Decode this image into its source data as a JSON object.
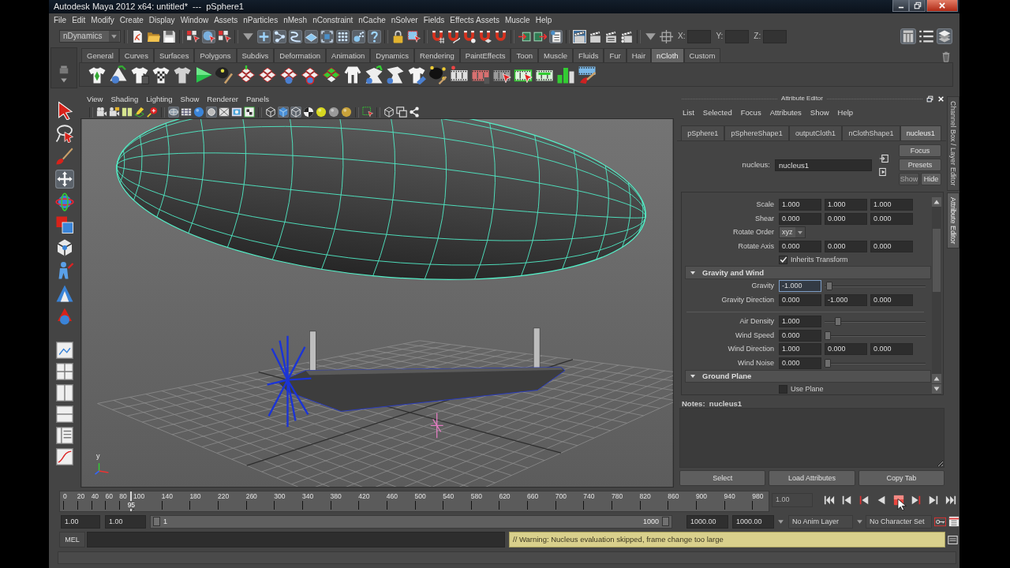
{
  "window": {
    "title": "Autodesk Maya 2012 x64: untitled*  ---  pSphere1"
  },
  "menu_bar": [
    "File",
    "Edit",
    "Modify",
    "Create",
    "Display",
    "Window",
    "Assets",
    "nParticles",
    "nMesh",
    "nConstraint",
    "nCache",
    "nSolver",
    "Fields",
    "Effects Assets",
    "Muscle",
    "Help"
  ],
  "status_line": {
    "menu_set": "nDynamics",
    "coordinate_labels": [
      "X:",
      "Y:",
      "Z:"
    ]
  },
  "shelf": {
    "tabs": [
      {
        "label": "General",
        "selected": false
      },
      {
        "label": "Curves",
        "selected": false
      },
      {
        "label": "Surfaces",
        "selected": false
      },
      {
        "label": "Polygons",
        "selected": false
      },
      {
        "label": "Subdivs",
        "selected": false
      },
      {
        "label": "Deformation",
        "selected": false
      },
      {
        "label": "Animation",
        "selected": false
      },
      {
        "label": "Dynamics",
        "selected": false
      },
      {
        "label": "Rendering",
        "selected": false
      },
      {
        "label": "PaintEffects",
        "selected": false
      },
      {
        "label": "Toon",
        "selected": false
      },
      {
        "label": "Muscle",
        "selected": false
      },
      {
        "label": "Fluids",
        "selected": false
      },
      {
        "label": "Fur",
        "selected": false
      },
      {
        "label": "Hair",
        "selected": false
      },
      {
        "label": "nCloth",
        "selected": true
      },
      {
        "label": "Custom",
        "selected": false
      }
    ]
  },
  "viewport": {
    "menu": [
      "View",
      "Shading",
      "Lighting",
      "Show",
      "Renderer",
      "Panels"
    ],
    "axis_label": "y"
  },
  "attribute_editor": {
    "title": "Attribute Editor",
    "menu": [
      "List",
      "Selected",
      "Focus",
      "Attributes",
      "Show",
      "Help"
    ],
    "tabs": [
      {
        "label": "pSphere1",
        "selected": false
      },
      {
        "label": "pSphereShape1",
        "selected": false
      },
      {
        "label": "outputCloth1",
        "selected": false
      },
      {
        "label": "nClothShape1",
        "selected": false
      },
      {
        "label": "nucleus1",
        "selected": true
      }
    ],
    "node_label": "nucleus:",
    "node_name": "nucleus1",
    "side_buttons": [
      {
        "label": "Focus",
        "disabled": false
      },
      {
        "label": "Presets",
        "disabled": false
      },
      {
        "label": "Show",
        "disabled": true
      },
      {
        "label": "Hide",
        "disabled": false
      }
    ],
    "rows": [
      {
        "kind": "vector",
        "label": "Scale",
        "values": [
          "1.000",
          "1.000",
          "1.000"
        ]
      },
      {
        "kind": "vector",
        "label": "Shear",
        "values": [
          "0.000",
          "0.000",
          "0.000"
        ]
      },
      {
        "kind": "dropdown",
        "label": "Rotate Order",
        "value": "xyz"
      },
      {
        "kind": "vector",
        "label": "Rotate Axis",
        "values": [
          "0.000",
          "0.000",
          "0.000"
        ]
      },
      {
        "kind": "checkbox",
        "label": "Inherits Transform",
        "checked": true
      },
      {
        "kind": "section",
        "label": "Gravity and Wind",
        "expanded": true
      },
      {
        "kind": "slider",
        "label": "Gravity",
        "value": "-1.000",
        "level": 0.02,
        "focused": true
      },
      {
        "kind": "vector",
        "label": "Gravity Direction",
        "values": [
          "0.000",
          "-1.000",
          "0.000"
        ]
      },
      {
        "kind": "divider"
      },
      {
        "kind": "slider",
        "label": "Air Density",
        "value": "1.000",
        "level": 0.11,
        "focused": false
      },
      {
        "kind": "slider",
        "label": "Wind Speed",
        "value": "0.000",
        "level": 0,
        "focused": false
      },
      {
        "kind": "vector",
        "label": "Wind Direction",
        "values": [
          "1.000",
          "0.000",
          "0.000"
        ]
      },
      {
        "kind": "slider",
        "label": "Wind Noise",
        "value": "0.000",
        "level": 0,
        "focused": false
      },
      {
        "kind": "section",
        "label": "Ground Plane",
        "expanded": true
      },
      {
        "kind": "checkbox",
        "label": "Use Plane",
        "checked": false
      }
    ],
    "notes_label": "Notes:  nucleus1",
    "buttons": [
      "Select",
      "Load Attributes",
      "Copy Tab"
    ]
  },
  "side_tabs": [
    {
      "label": "Channel Box / Layer Editor",
      "selected": false
    },
    {
      "label": "Attribute Editor",
      "selected": true
    }
  ],
  "time_slider": {
    "ticks": [
      "0",
      "20",
      "40",
      "60",
      "80",
      "100",
      "140",
      "180",
      "220",
      "260",
      "300",
      "340",
      "380",
      "420",
      "460",
      "500",
      "540",
      "580",
      "620",
      "660",
      "700",
      "740",
      "780",
      "820",
      "860",
      "900",
      "940",
      "980"
    ],
    "level": 0.095,
    "current_frame": "95",
    "current_time": {
      "value": "1.00",
      "disabled": true
    },
    "playing": true
  },
  "range_slider": {
    "start_time": "1.00",
    "playback_start": "1.00",
    "level": 1,
    "range_start": "1",
    "range_end": "1000",
    "playback_end": "1000.00",
    "end_time": "1000.00",
    "anim_layer": "No Anim Layer",
    "character_set": "No Character Set"
  },
  "command_line": {
    "language": "MEL",
    "result": "// Warning: Nucleus evaluation skipped, frame change too large"
  }
}
